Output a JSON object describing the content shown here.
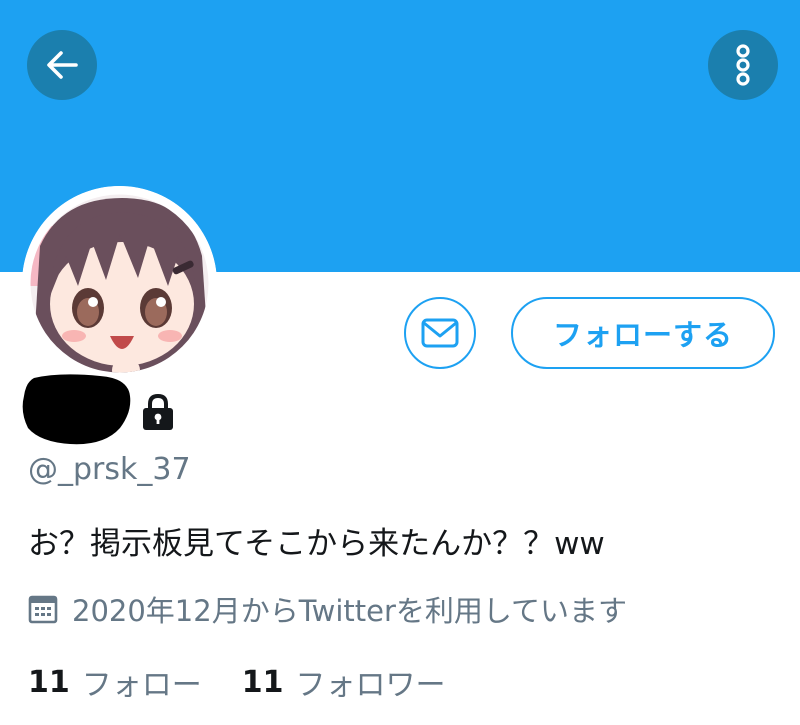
{
  "header": {
    "back_icon": "arrow-left-icon",
    "more_icon": "more-vertical-icon",
    "banner_color": "#1da1f2"
  },
  "profile": {
    "handle": "@_prsk_37",
    "bio": "お？掲示板見てそこから来たんか？？ww",
    "joined": "2020年12月からTwitterを利用しています",
    "protected_icon": "lock-icon"
  },
  "actions": {
    "message_icon": "envelope-icon",
    "follow_label": "フォローする"
  },
  "stats": {
    "following_count": "11",
    "following_label": "フォロー",
    "followers_count": "11",
    "followers_label": "フォロワー"
  },
  "colors": {
    "accent": "#1da1f2",
    "secondary_text": "#657786"
  }
}
